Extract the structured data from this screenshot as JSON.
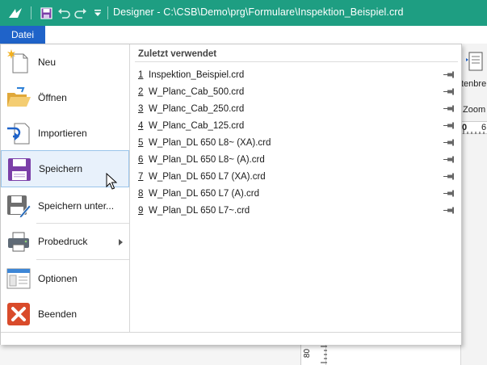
{
  "titlebar": {
    "title": "Designer - C:\\CSB\\Demo\\prg\\Formulare\\Inspektion_Beispiel.crd",
    "bg_color": "#1e9e82",
    "icons": [
      "app-logo-icon",
      "save-icon",
      "undo-icon",
      "redo-icon",
      "customize-dropdown-icon"
    ]
  },
  "menu_tab": {
    "label": "Datei",
    "color": "#1f63c9"
  },
  "file_menu": {
    "items": [
      {
        "label": "Neu",
        "icon": "new-document-icon"
      },
      {
        "label": "Öffnen",
        "icon": "open-folder-icon"
      },
      {
        "label": "Importieren",
        "icon": "import-icon"
      },
      {
        "label": "Speichern",
        "icon": "save-icon",
        "active": true
      },
      {
        "label": "Speichern unter...",
        "icon": "save-as-icon"
      },
      {
        "label": "Probedruck",
        "icon": "printer-icon",
        "submenu": true
      },
      {
        "label": "Optionen",
        "icon": "options-window-icon"
      },
      {
        "label": "Beenden",
        "icon": "exit-icon"
      }
    ]
  },
  "recent": {
    "title": "Zuletzt verwendet",
    "files": [
      {
        "num": "1",
        "name": "Inspektion_Beispiel.crd"
      },
      {
        "num": "2",
        "name": "W_Planc_Cab_500.crd"
      },
      {
        "num": "3",
        "name": "W_Planc_Cab_250.crd"
      },
      {
        "num": "4",
        "name": "W_Planc_Cab_125.crd"
      },
      {
        "num": "5",
        "name": "W_Plan_DL 650 L8~ (XA).crd"
      },
      {
        "num": "6",
        "name": "W_Plan_DL 650 L8~ (A).crd"
      },
      {
        "num": "7",
        "name": "W_Plan_DL 650 L7 (XA).crd"
      },
      {
        "num": "8",
        "name": "W_Plan_DL 650 L7 (A).crd"
      },
      {
        "num": "9",
        "name": "W_Plan_DL 650 L7~.crd"
      }
    ]
  },
  "background_app": {
    "ribbon_label": "tenbre",
    "zoom_label": "Zoom",
    "ruler_label": "0",
    "ruler_label2": "6",
    "vruler_label": "80"
  }
}
